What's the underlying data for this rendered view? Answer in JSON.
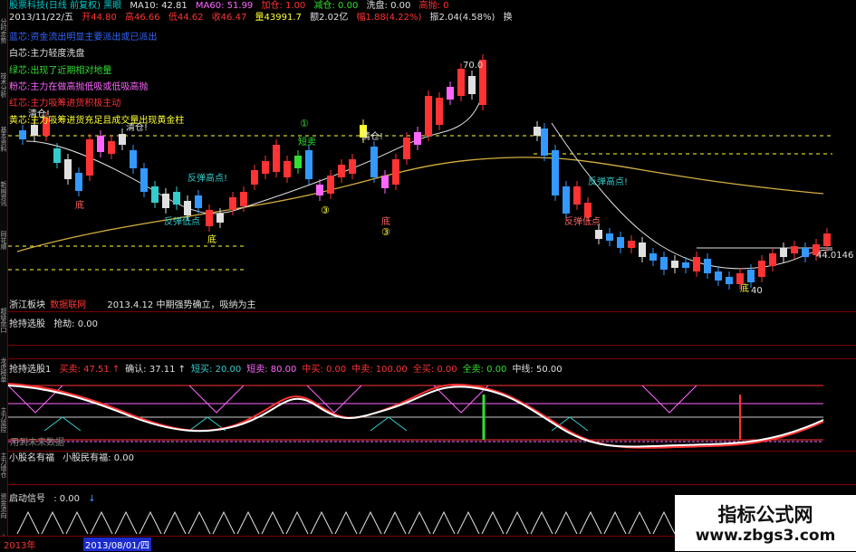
{
  "header": {
    "title": "股票科技(日线 前复权) 黑眼",
    "ma10": "MA10: 42.81",
    "ma60": "MA60: 51.99",
    "tag1": "加仓: 1.00",
    "tag2": "减仓: 0.00",
    "tag3": "洗盘: 0.00",
    "tag4": "高抛: 0"
  },
  "quote": {
    "date": "2013/11/22/五",
    "open": "开44.80",
    "high": "高46.66",
    "low": "低44.62",
    "close": "收46.47",
    "volume": "量43991.7",
    "amount": "额2.02亿",
    "change": "幅1.88(4.22%)",
    "amplitude": "振2.04(4.58%)",
    "turnover": "换"
  },
  "legend": [
    {
      "text": "蓝芯:资金流出明显主要派出或已派出",
      "color": "#3366ff"
    },
    {
      "text": "白芯:主力轻度洗盘",
      "color": "#e0e0e0"
    },
    {
      "text": "绿芯:出现了近期相对地量",
      "color": "#33dd33"
    },
    {
      "text": "粉芯:主力在做高抛低吸或低吸高抛",
      "color": "#ff66ff"
    },
    {
      "text": "红芯:主力吸筹进货积极主动",
      "color": "#ff3333"
    },
    {
      "text": "黄芯:主力吸筹进货充足且成交量出现黄金柱",
      "color": "#ffff33"
    }
  ],
  "chart_labels": {
    "top_price": "70.0",
    "right_price": "44.0146",
    "low_price": "40",
    "qingcang1": "清仓!",
    "qingcang2": "清仓!",
    "qingcang3": "清仓!",
    "duanmai": "短卖",
    "fantan1": "反弹高点!",
    "fantan2": "反弹高点!",
    "fantan_low1": "反弹低点",
    "fantan_low2": "反弹低点",
    "di1": "底",
    "di2": "底",
    "di3": "底",
    "di4": "底",
    "circle1": "①",
    "circle2": "③",
    "circle3": "③"
  },
  "footer_main": {
    "sector": "浙江板块",
    "sector2": "数据联网",
    "note": "2013.4.12 中期强势确立，吸纳为主"
  },
  "panel1": {
    "label": "抢持选股",
    "value": "抢劫: 0.00"
  },
  "panel2": {
    "label": "抢持选股1",
    "items": [
      {
        "text": "买卖: 47.51",
        "color": "#ff3333",
        "arrow": "↑"
      },
      {
        "text": "确认: 37.11",
        "color": "#e0e0e0",
        "arrow": "↑"
      },
      {
        "text": "短买: 20.00",
        "color": "#33cccc",
        "arrow": ""
      },
      {
        "text": "短卖: 80.00",
        "color": "#ff66ff",
        "arrow": ""
      },
      {
        "text": "中买: 0.00",
        "color": "#ff3333",
        "arrow": ""
      },
      {
        "text": "中卖: 100.00",
        "color": "#ff3333",
        "arrow": ""
      },
      {
        "text": "全买: 0.00",
        "color": "#ff3333",
        "arrow": ""
      },
      {
        "text": "全卖: 0.00",
        "color": "#33dd33",
        "arrow": ""
      },
      {
        "text": "中线: 50.00",
        "color": "#e0e0e0",
        "arrow": ""
      }
    ],
    "overlay": "用到未来数据"
  },
  "panel3": {
    "label": "小股名有福",
    "value": "小股民有福: 0.00"
  },
  "panel4": {
    "label": "启动信号",
    "value": ": 0.00"
  },
  "bottom": {
    "year": "2013年",
    "date": "2013/08/01/四"
  },
  "sidebar_tabs": [
    "分时走势",
    "技术分析",
    "基本资料",
    "新闻资讯",
    "同花顺",
    "超级盘口",
    "龙虎榜单",
    "主力监控",
    "主力增仓",
    "资金流向",
    "小股"
  ],
  "watermark": {
    "title": "指标公式网",
    "url": "www.zbgs3.com"
  }
}
